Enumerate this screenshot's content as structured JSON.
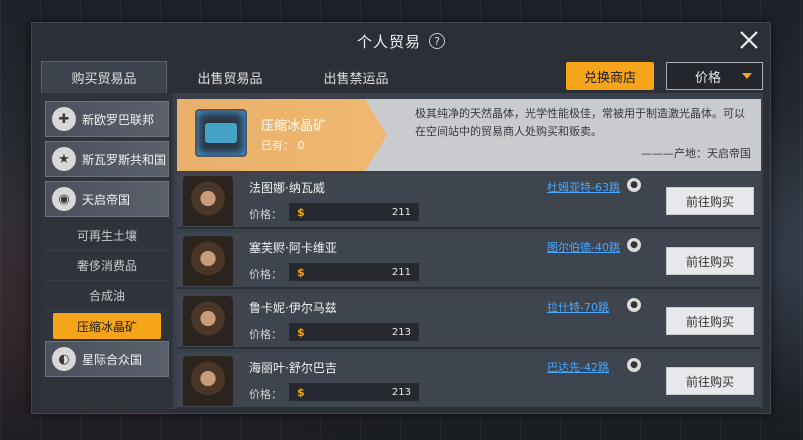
{
  "window": {
    "title": "个人贸易",
    "help_icon": "?"
  },
  "tabs": [
    {
      "label": "购买贸易品",
      "active": true
    },
    {
      "label": "出售贸易品",
      "active": false
    },
    {
      "label": "出售禁运品",
      "active": false
    }
  ],
  "toolbar": {
    "exchange_label": "兑换商店",
    "sort_value": "价格"
  },
  "sidebar": {
    "factions": [
      {
        "label": "新欧罗巴联邦",
        "icon": "cross-emblem-icon"
      },
      {
        "label": "斯瓦罗斯共和国",
        "icon": "star-emblem-icon"
      },
      {
        "label": "天启帝国",
        "icon": "planet-emblem-icon"
      }
    ],
    "subitems": [
      {
        "label": "可再生土壤"
      },
      {
        "label": "奢侈消费品"
      },
      {
        "label": "合成油"
      },
      {
        "label": "压缩冰晶矿",
        "active": true
      }
    ],
    "faction_bottom": {
      "label": "星际合众国",
      "icon": "swirl-emblem-icon"
    }
  },
  "item": {
    "name": "压缩冰晶矿",
    "owned": "已有： 0",
    "description": "极其纯净的天然晶体，光学性能极佳，常被用于制造激光晶体。可以在空间站中的贸易商人处购买和贩卖。",
    "origin": "———产地：天启帝国"
  },
  "merchants": [
    {
      "name": "法图娜·纳瓦威",
      "location": "杜姆亚特-63跳",
      "price_label": "价格：",
      "price": "211",
      "buy_label": "前往购买"
    },
    {
      "name": "塞芙赆·阿卡维亚",
      "location": "图尔伯德-40跳",
      "price_label": "价格：",
      "price": "211",
      "buy_label": "前往购买"
    },
    {
      "name": "鲁卡妮·伊尔马兹",
      "location": "拉什特-70跳",
      "price_label": "价格：",
      "price": "213",
      "buy_label": "前往购买"
    },
    {
      "name": "海丽叶·舒尔巴吉",
      "location": "巴达先-42跳",
      "price_label": "价格：",
      "price": "213",
      "buy_label": "前往购买"
    }
  ],
  "colors": {
    "accent": "#f6a51b",
    "link": "#4aa6ff"
  }
}
